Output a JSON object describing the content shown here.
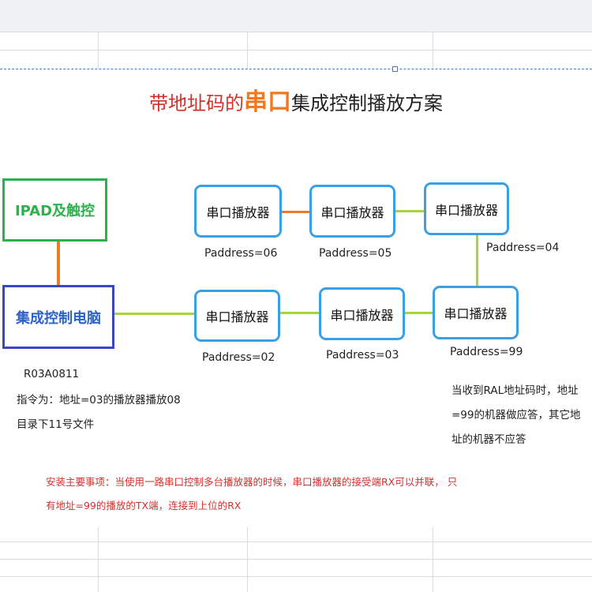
{
  "title": {
    "part1": "带地址码的",
    "part2": "串口",
    "part3": "集成控制播放方案"
  },
  "nodes": {
    "ipad": "IPAD及触控",
    "pc": "集成控制电脑",
    "player_label": "串口播放器"
  },
  "addresses": {
    "p06": "Paddress=06",
    "p05": "Paddress=05",
    "p04": "Paddress=04",
    "p02": "Paddress=02",
    "p03": "Paddress=03",
    "p99": "Paddress=99"
  },
  "left_note": {
    "code": "R03A0811",
    "line1": "指令为：地址=03的播放器播放08",
    "line2": "目录下11号文件"
  },
  "right_note": {
    "line1": "当收到RAL地址码时，地址",
    "line2": "=99的机器做应答，其它地",
    "line3": "址的机器不应答"
  },
  "warning": {
    "line1": "安装主要事项：当使用一路串口控制多台播放器的时候，串口播放器的接受端RX可以并联， 只",
    "line2": "有地址=99的播放的TX端，连接到上位的RX"
  },
  "colors": {
    "player_border": "#3aa0e6",
    "ipad_border": "#2bb24c",
    "pc_border": "#3b46c2",
    "orange_wire": "#f07921",
    "green_wire": "#a6d63a",
    "warning_text": "#d4312b"
  }
}
